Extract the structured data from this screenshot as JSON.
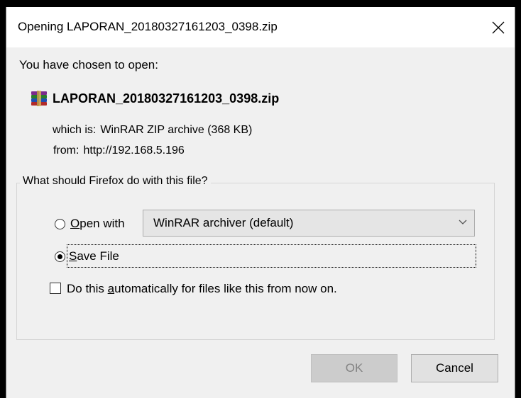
{
  "window": {
    "title": "Opening LAPORAN_20180327161203_0398.zip",
    "close_glyph": "close-icon"
  },
  "file": {
    "intro": "You have chosen to open:",
    "icon": "winrar-archive-icon",
    "name": "LAPORAN_20180327161203_0398.zip",
    "type_key": "which is:",
    "type_value": "WinRAR ZIP archive (368 KB)",
    "from_key": "from:",
    "from_value": "http://192.168.5.196"
  },
  "action_group": {
    "legend": "What should Firefox do with this file?",
    "open_with": {
      "label_mnemonic": "O",
      "label_rest": "pen with",
      "selected": false
    },
    "open_with_app": "WinRAR archiver (default)",
    "save_file": {
      "label_mnemonic": "S",
      "label_rest": "ave File",
      "selected": true
    },
    "auto": {
      "label_pre": "Do this ",
      "label_mnemonic": "a",
      "label_post": "utomatically for files like this from now on.",
      "checked": false
    }
  },
  "buttons": {
    "ok": "OK",
    "cancel": "Cancel"
  },
  "colors": {
    "dialog_bg": "#f0f0f0",
    "titlebar_bg": "#ffffff",
    "disabled_text": "#838383"
  }
}
